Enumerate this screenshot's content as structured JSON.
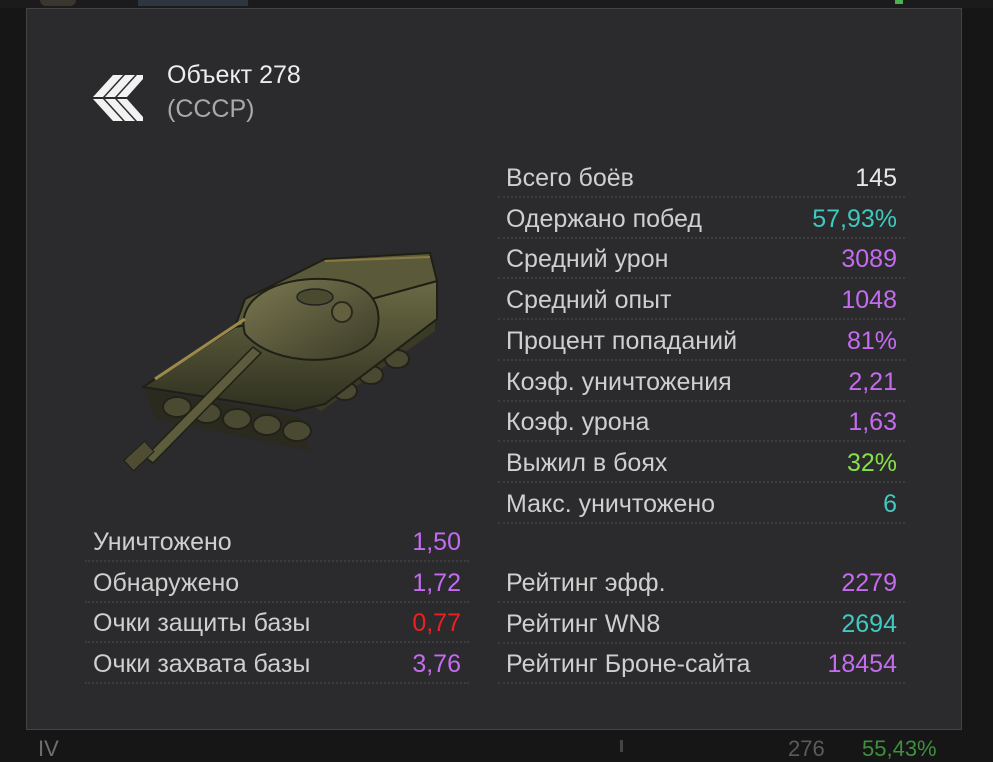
{
  "tank": {
    "name": "Объект 278",
    "nation": "(СССР)",
    "class_icon": "heavy-tank-class-icon"
  },
  "main_stats": [
    {
      "label": "Всего боёв",
      "value": "145",
      "color": "#e6e6e6"
    },
    {
      "label": "Одержано побед",
      "value": "57,93%",
      "color": "#3fc9c0"
    },
    {
      "label": "Средний урон",
      "value": "3089",
      "color": "#c46bf0"
    },
    {
      "label": "Средний опыт",
      "value": "1048",
      "color": "#c46bf0"
    },
    {
      "label": "Процент попаданий",
      "value": "81%",
      "color": "#c46bf0"
    },
    {
      "label": "Коэф. уничтожения",
      "value": "2,21",
      "color": "#c46bf0"
    },
    {
      "label": "Коэф. урона",
      "value": "1,63",
      "color": "#c46bf0"
    },
    {
      "label": "Выжил в боях",
      "value": "32%",
      "color": "#86e04a"
    },
    {
      "label": "Макс. уничтожено",
      "value": "6",
      "color": "#3fc9c0"
    }
  ],
  "avg_stats": [
    {
      "label": "Уничтожено",
      "value": "1,50",
      "color": "#c46bf0"
    },
    {
      "label": "Обнаружено",
      "value": "1,72",
      "color": "#c46bf0"
    },
    {
      "label": "Очки защиты базы",
      "value": "0,77",
      "color": "#f01f1f"
    },
    {
      "label": "Очки захвата базы",
      "value": "3,76",
      "color": "#c46bf0"
    }
  ],
  "ratings": [
    {
      "label": "Рейтинг эфф.",
      "value": "2279",
      "color": "#c46bf0"
    },
    {
      "label": "Рейтинг WN8",
      "value": "2694",
      "color": "#3fc9c0"
    },
    {
      "label": "Рейтинг Броне-сайта",
      "value": "18454",
      "color": "#c46bf0"
    }
  ],
  "background": {
    "next_row_tier": "IV",
    "next_row_battles": "276",
    "next_row_winrate": "55,43%"
  }
}
